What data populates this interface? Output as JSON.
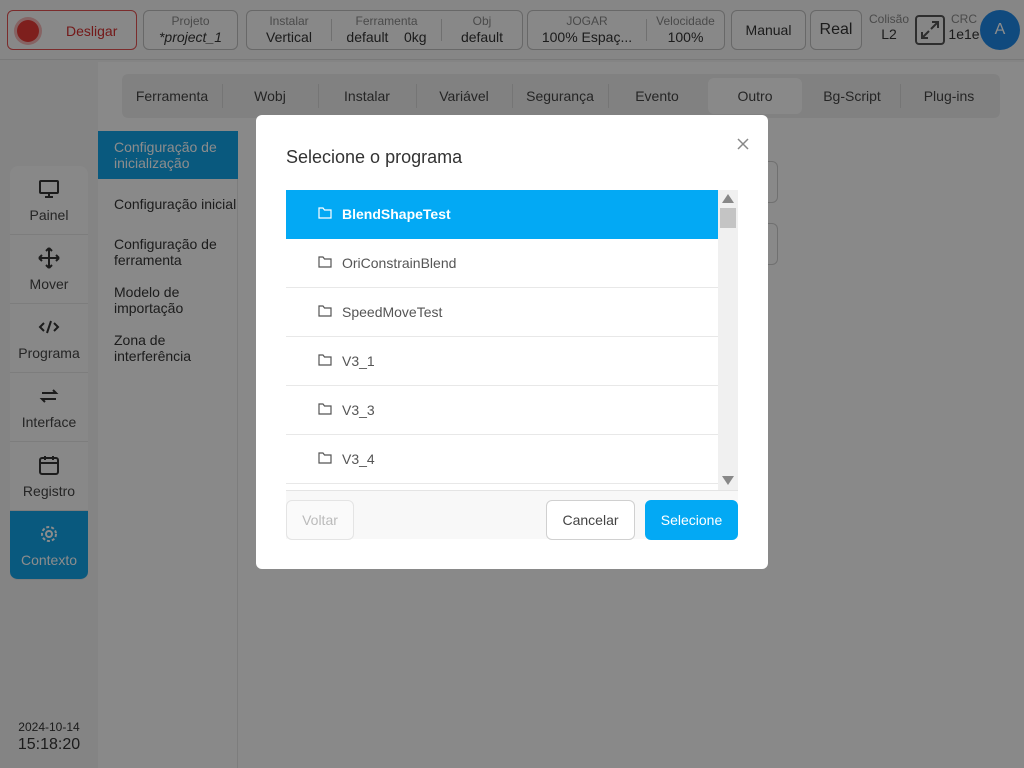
{
  "topbar": {
    "stop_label": "Desligar",
    "project": {
      "label": "Projeto",
      "value": "*project_1"
    },
    "install": {
      "label": "Instalar",
      "value": "Vertical"
    },
    "tool": {
      "label": "Ferramenta",
      "value": "default",
      "extra": "0kg"
    },
    "obj": {
      "label": "Obj",
      "value": "default"
    },
    "jog": {
      "label": "JOGAR",
      "value": "100%  Espaç..."
    },
    "speed": {
      "label": "Velocidade",
      "value": "100%"
    },
    "manual_label": "Manual",
    "real_label": "Real",
    "collision": {
      "label": "Colisão",
      "value": "L2"
    },
    "crc": {
      "label": "CRC",
      "value": "1e1e"
    },
    "avatar_letter": "A"
  },
  "leftnav": {
    "items": [
      {
        "label": "Painel",
        "icon": "monitor-icon"
      },
      {
        "label": "Mover",
        "icon": "move-icon"
      },
      {
        "label": "Programa",
        "icon": "code-icon"
      },
      {
        "label": "Interface",
        "icon": "swap-icon"
      },
      {
        "label": "Registro",
        "icon": "calendar-icon"
      },
      {
        "label": "Contexto",
        "icon": "gear-icon"
      }
    ],
    "date": "2024-10-14",
    "time": "15:18:20"
  },
  "tabs": [
    "Ferramenta",
    "Wobj",
    "Instalar",
    "Variável",
    "Segurança",
    "Evento",
    "Outro",
    "Bg-Script",
    "Plug-ins"
  ],
  "active_tab": "Outro",
  "subnav": [
    "Configuração de inicialização",
    "Configuração inicial",
    "Configuração de ferramenta",
    "Modelo de importação",
    "Zona de interferência"
  ],
  "modal": {
    "title": "Selecione o programa",
    "items": [
      "BlendShapeTest",
      "OriConstrainBlend",
      "SpeedMoveTest",
      "V3_1",
      "V3_3",
      "V3_4"
    ],
    "selected": "BlendShapeTest",
    "back_label": "Voltar",
    "cancel_label": "Cancelar",
    "select_label": "Selecione"
  },
  "colors": {
    "accent": "#03a9f4",
    "nav_active": "#12a3e6",
    "stop": "#e53935"
  }
}
